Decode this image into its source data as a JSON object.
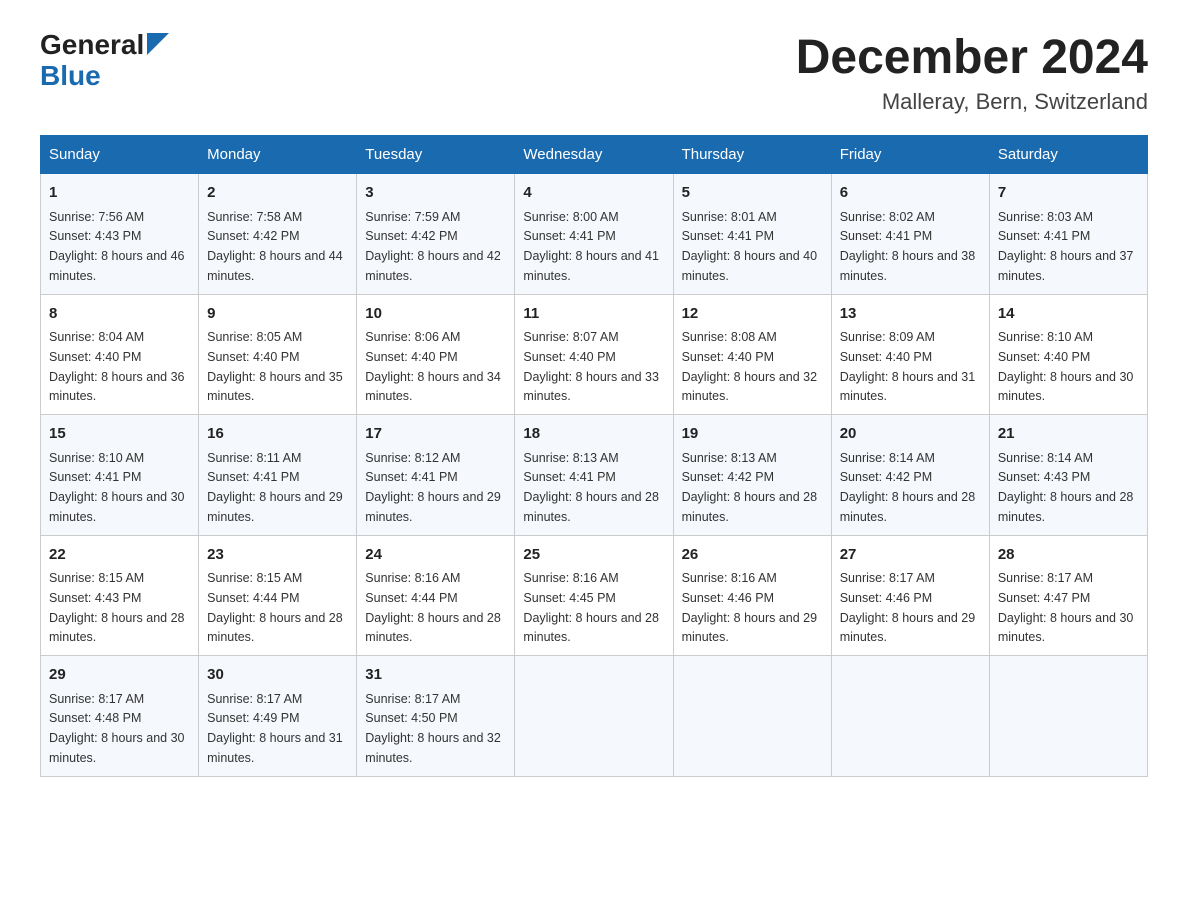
{
  "header": {
    "logo_general": "General",
    "logo_blue": "Blue",
    "month_year": "December 2024",
    "location": "Malleray, Bern, Switzerland"
  },
  "days_of_week": [
    "Sunday",
    "Monday",
    "Tuesday",
    "Wednesday",
    "Thursday",
    "Friday",
    "Saturday"
  ],
  "weeks": [
    [
      {
        "num": "1",
        "sunrise": "7:56 AM",
        "sunset": "4:43 PM",
        "daylight": "8 hours and 46 minutes."
      },
      {
        "num": "2",
        "sunrise": "7:58 AM",
        "sunset": "4:42 PM",
        "daylight": "8 hours and 44 minutes."
      },
      {
        "num": "3",
        "sunrise": "7:59 AM",
        "sunset": "4:42 PM",
        "daylight": "8 hours and 42 minutes."
      },
      {
        "num": "4",
        "sunrise": "8:00 AM",
        "sunset": "4:41 PM",
        "daylight": "8 hours and 41 minutes."
      },
      {
        "num": "5",
        "sunrise": "8:01 AM",
        "sunset": "4:41 PM",
        "daylight": "8 hours and 40 minutes."
      },
      {
        "num": "6",
        "sunrise": "8:02 AM",
        "sunset": "4:41 PM",
        "daylight": "8 hours and 38 minutes."
      },
      {
        "num": "7",
        "sunrise": "8:03 AM",
        "sunset": "4:41 PM",
        "daylight": "8 hours and 37 minutes."
      }
    ],
    [
      {
        "num": "8",
        "sunrise": "8:04 AM",
        "sunset": "4:40 PM",
        "daylight": "8 hours and 36 minutes."
      },
      {
        "num": "9",
        "sunrise": "8:05 AM",
        "sunset": "4:40 PM",
        "daylight": "8 hours and 35 minutes."
      },
      {
        "num": "10",
        "sunrise": "8:06 AM",
        "sunset": "4:40 PM",
        "daylight": "8 hours and 34 minutes."
      },
      {
        "num": "11",
        "sunrise": "8:07 AM",
        "sunset": "4:40 PM",
        "daylight": "8 hours and 33 minutes."
      },
      {
        "num": "12",
        "sunrise": "8:08 AM",
        "sunset": "4:40 PM",
        "daylight": "8 hours and 32 minutes."
      },
      {
        "num": "13",
        "sunrise": "8:09 AM",
        "sunset": "4:40 PM",
        "daylight": "8 hours and 31 minutes."
      },
      {
        "num": "14",
        "sunrise": "8:10 AM",
        "sunset": "4:40 PM",
        "daylight": "8 hours and 30 minutes."
      }
    ],
    [
      {
        "num": "15",
        "sunrise": "8:10 AM",
        "sunset": "4:41 PM",
        "daylight": "8 hours and 30 minutes."
      },
      {
        "num": "16",
        "sunrise": "8:11 AM",
        "sunset": "4:41 PM",
        "daylight": "8 hours and 29 minutes."
      },
      {
        "num": "17",
        "sunrise": "8:12 AM",
        "sunset": "4:41 PM",
        "daylight": "8 hours and 29 minutes."
      },
      {
        "num": "18",
        "sunrise": "8:13 AM",
        "sunset": "4:41 PM",
        "daylight": "8 hours and 28 minutes."
      },
      {
        "num": "19",
        "sunrise": "8:13 AM",
        "sunset": "4:42 PM",
        "daylight": "8 hours and 28 minutes."
      },
      {
        "num": "20",
        "sunrise": "8:14 AM",
        "sunset": "4:42 PM",
        "daylight": "8 hours and 28 minutes."
      },
      {
        "num": "21",
        "sunrise": "8:14 AM",
        "sunset": "4:43 PM",
        "daylight": "8 hours and 28 minutes."
      }
    ],
    [
      {
        "num": "22",
        "sunrise": "8:15 AM",
        "sunset": "4:43 PM",
        "daylight": "8 hours and 28 minutes."
      },
      {
        "num": "23",
        "sunrise": "8:15 AM",
        "sunset": "4:44 PM",
        "daylight": "8 hours and 28 minutes."
      },
      {
        "num": "24",
        "sunrise": "8:16 AM",
        "sunset": "4:44 PM",
        "daylight": "8 hours and 28 minutes."
      },
      {
        "num": "25",
        "sunrise": "8:16 AM",
        "sunset": "4:45 PM",
        "daylight": "8 hours and 28 minutes."
      },
      {
        "num": "26",
        "sunrise": "8:16 AM",
        "sunset": "4:46 PM",
        "daylight": "8 hours and 29 minutes."
      },
      {
        "num": "27",
        "sunrise": "8:17 AM",
        "sunset": "4:46 PM",
        "daylight": "8 hours and 29 minutes."
      },
      {
        "num": "28",
        "sunrise": "8:17 AM",
        "sunset": "4:47 PM",
        "daylight": "8 hours and 30 minutes."
      }
    ],
    [
      {
        "num": "29",
        "sunrise": "8:17 AM",
        "sunset": "4:48 PM",
        "daylight": "8 hours and 30 minutes."
      },
      {
        "num": "30",
        "sunrise": "8:17 AM",
        "sunset": "4:49 PM",
        "daylight": "8 hours and 31 minutes."
      },
      {
        "num": "31",
        "sunrise": "8:17 AM",
        "sunset": "4:50 PM",
        "daylight": "8 hours and 32 minutes."
      },
      null,
      null,
      null,
      null
    ]
  ]
}
